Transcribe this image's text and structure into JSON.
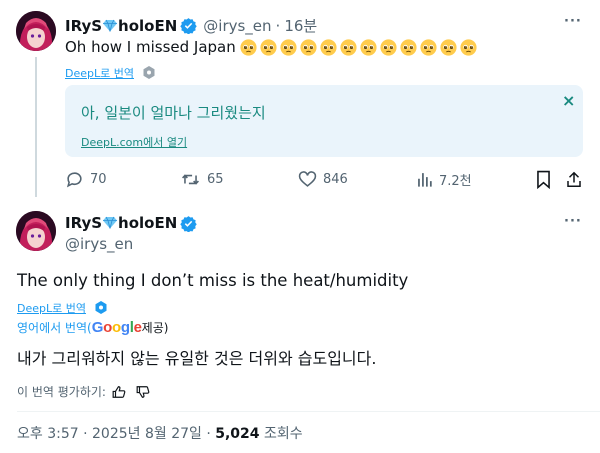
{
  "first_tweet": {
    "display_name": "IRyS",
    "display_name_suffix": "holoEN",
    "handle": "@irys_en",
    "separator": "·",
    "time_ago": "16분",
    "text": "Oh how I missed Japan",
    "emoji_count": 12,
    "deepl_link": "DeepL로 번역",
    "translation_text": "아, 일본이 얼마나 그리웠는지",
    "translation_open_link": "DeepL.com에서 열기",
    "close_symbol": "×",
    "more_symbol": "···",
    "actions": {
      "replies": "70",
      "retweets": "65",
      "likes": "846",
      "views": "7.2천"
    }
  },
  "main_tweet": {
    "display_name": "IRyS",
    "display_name_suffix": "holoEN",
    "handle": "@irys_en",
    "more_symbol": "···",
    "text": "The only thing I don’t miss is the heat/humidity",
    "deepl_link": "DeepL로 번역",
    "google_prefix": "영어에서 번역(",
    "google_logo": "Google",
    "google_suffix": " 제공)",
    "translation_text": "내가 그리워하지 않는 유일한 것은 더위와 습도입니다.",
    "rate_translation": "이 번역 평가하기:",
    "timestamp": "오후 3:57 · 2025년 8월 27일 · ",
    "view_count": "5,024",
    "view_label": " 조회수"
  },
  "colors": {
    "accent": "#1d9bf0",
    "muted": "#536471",
    "translation_bg": "#eaf4fb",
    "translation_text": "#1a8a80",
    "border": "#eff3f4"
  },
  "icons": [
    "avatar",
    "verified-badge-icon",
    "diamond-icon",
    "pleading-face-emoji",
    "deepl-badge-icon",
    "close-icon",
    "more-icon",
    "reply-icon",
    "retweet-icon",
    "like-icon",
    "views-icon",
    "bookmark-icon",
    "share-icon",
    "thumbs-up-icon",
    "thumbs-down-icon",
    "google-logo"
  ]
}
